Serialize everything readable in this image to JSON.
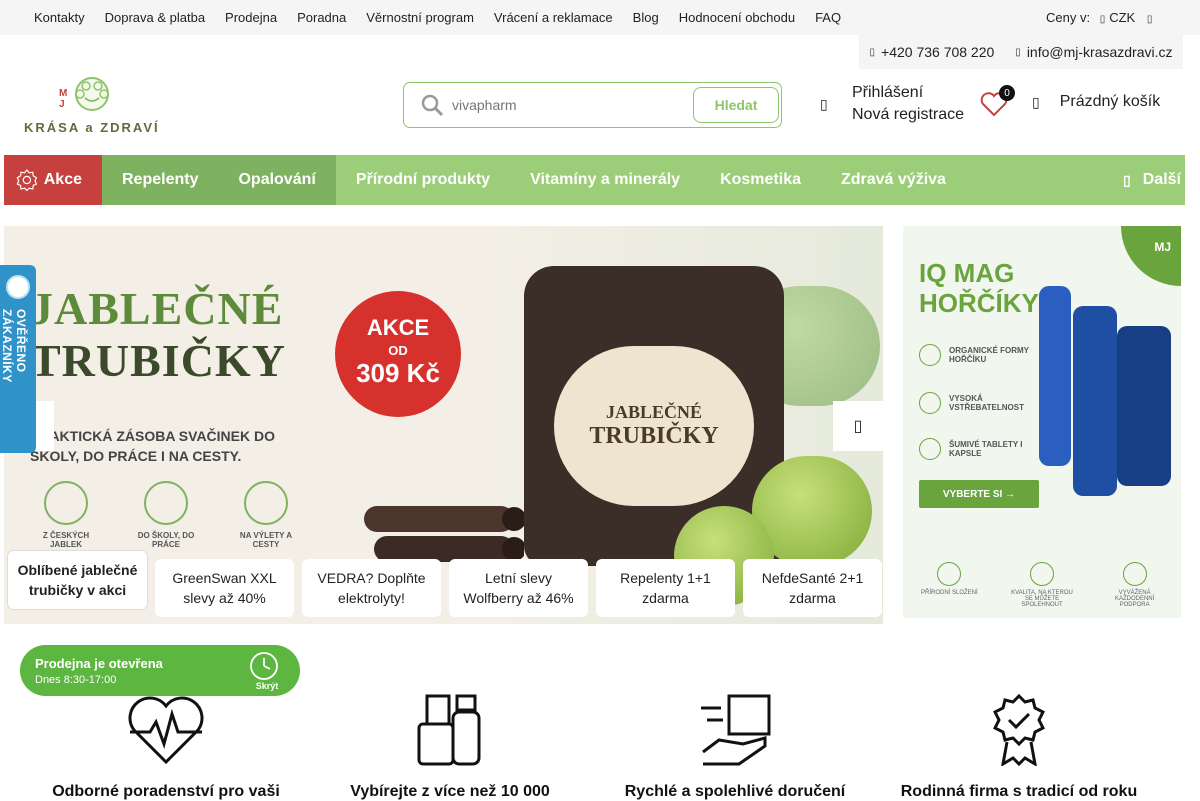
{
  "topbar": {
    "links": [
      "Kontakty",
      "Doprava & platba",
      "Prodejna",
      "Poradna",
      "Věrnostní program",
      "Vrácení a reklamace",
      "Blog",
      "Hodnocení obchodu",
      "FAQ"
    ],
    "prices_label": "Ceny v:",
    "currency": "CZK"
  },
  "contact": {
    "phone": "+420 736 708 220",
    "email": "info@mj-krasazdravi.cz"
  },
  "logo": {
    "text": "KRÁSA a ZDRAVÍ",
    "mono": "M J"
  },
  "search": {
    "placeholder": "vivapharm",
    "button": "Hledat"
  },
  "account": {
    "login": "Přihlášení",
    "register": "Nová registrace"
  },
  "wishlist": {
    "count": "0"
  },
  "cart": {
    "label": "Prázdný košík"
  },
  "nav": {
    "items": [
      "Akce",
      "Repelenty",
      "Opalování",
      "Přírodní produkty",
      "Vitamíny a minerály",
      "Kosmetika",
      "Zdravá výživa"
    ],
    "more": "Další"
  },
  "hero": {
    "title_line1": "JABLEČNÉ",
    "title_line2": "TRUBIČKY",
    "subtitle": "Praktická zásoba svačinek do školy, do práce i na cesty.",
    "promo_1": "AKCE",
    "promo_2": "OD",
    "promo_3": "309 Kč",
    "jar_label_1": "JABLEČNÉ",
    "jar_label_2": "TRUBIČKY",
    "icons": [
      "Z ČESKÝCH JABLEK",
      "DO ŠKOLY, DO PRÁCE",
      "NA VÝLETY A CESTY"
    ]
  },
  "slider_tabs": [
    "Oblíbené jablečné trubičky v akci",
    "GreenSwan XXL slevy až 40%",
    "VEDRA? Doplňte elektrolyty!",
    "Letní slevy Wolfberry až 46%",
    "Repelenty 1+1 zdarma",
    "NefdeSanté 2+1 zdarma"
  ],
  "side_banner": {
    "title_1": "IQ MAG",
    "title_2": "HOŘČÍKY",
    "features": [
      "ORGANICKÉ FORMY HOŘČÍKU",
      "VYSOKÁ VSTŘEBATELNOST",
      "ŠUMIVÉ TABLETY I KAPSLE"
    ],
    "cta": "VYBERTE SI →",
    "brand": "MJ",
    "bottom_features": [
      "PŘÍRODNÍ SLOŽENÍ",
      "KVALITA, NA KTEROU SE MŮŽETE SPOLEHNOUT",
      "VYVÁŽENÁ KAŽDODENNÍ PODPORA"
    ]
  },
  "verified": {
    "label": "OVĚŘENO ZÁKAZNÍKY"
  },
  "store_status": {
    "status": "Prodejna je otevřena",
    "hours": "Dnes 8:30-17:00",
    "hide": "Skrýt"
  },
  "benefits": [
    "Odborné poradenství pro vaši",
    "Vybírejte z více než 10 000",
    "Rychlé a spolehlivé doručení",
    "Rodinná firma s tradicí od roku"
  ],
  "colors": {
    "nav_green": "#9ccd78",
    "akce_red": "#c6413d",
    "accent_green": "#8dc56d",
    "badge_blue": "#2f93c9",
    "open_green": "#5cb63f"
  }
}
